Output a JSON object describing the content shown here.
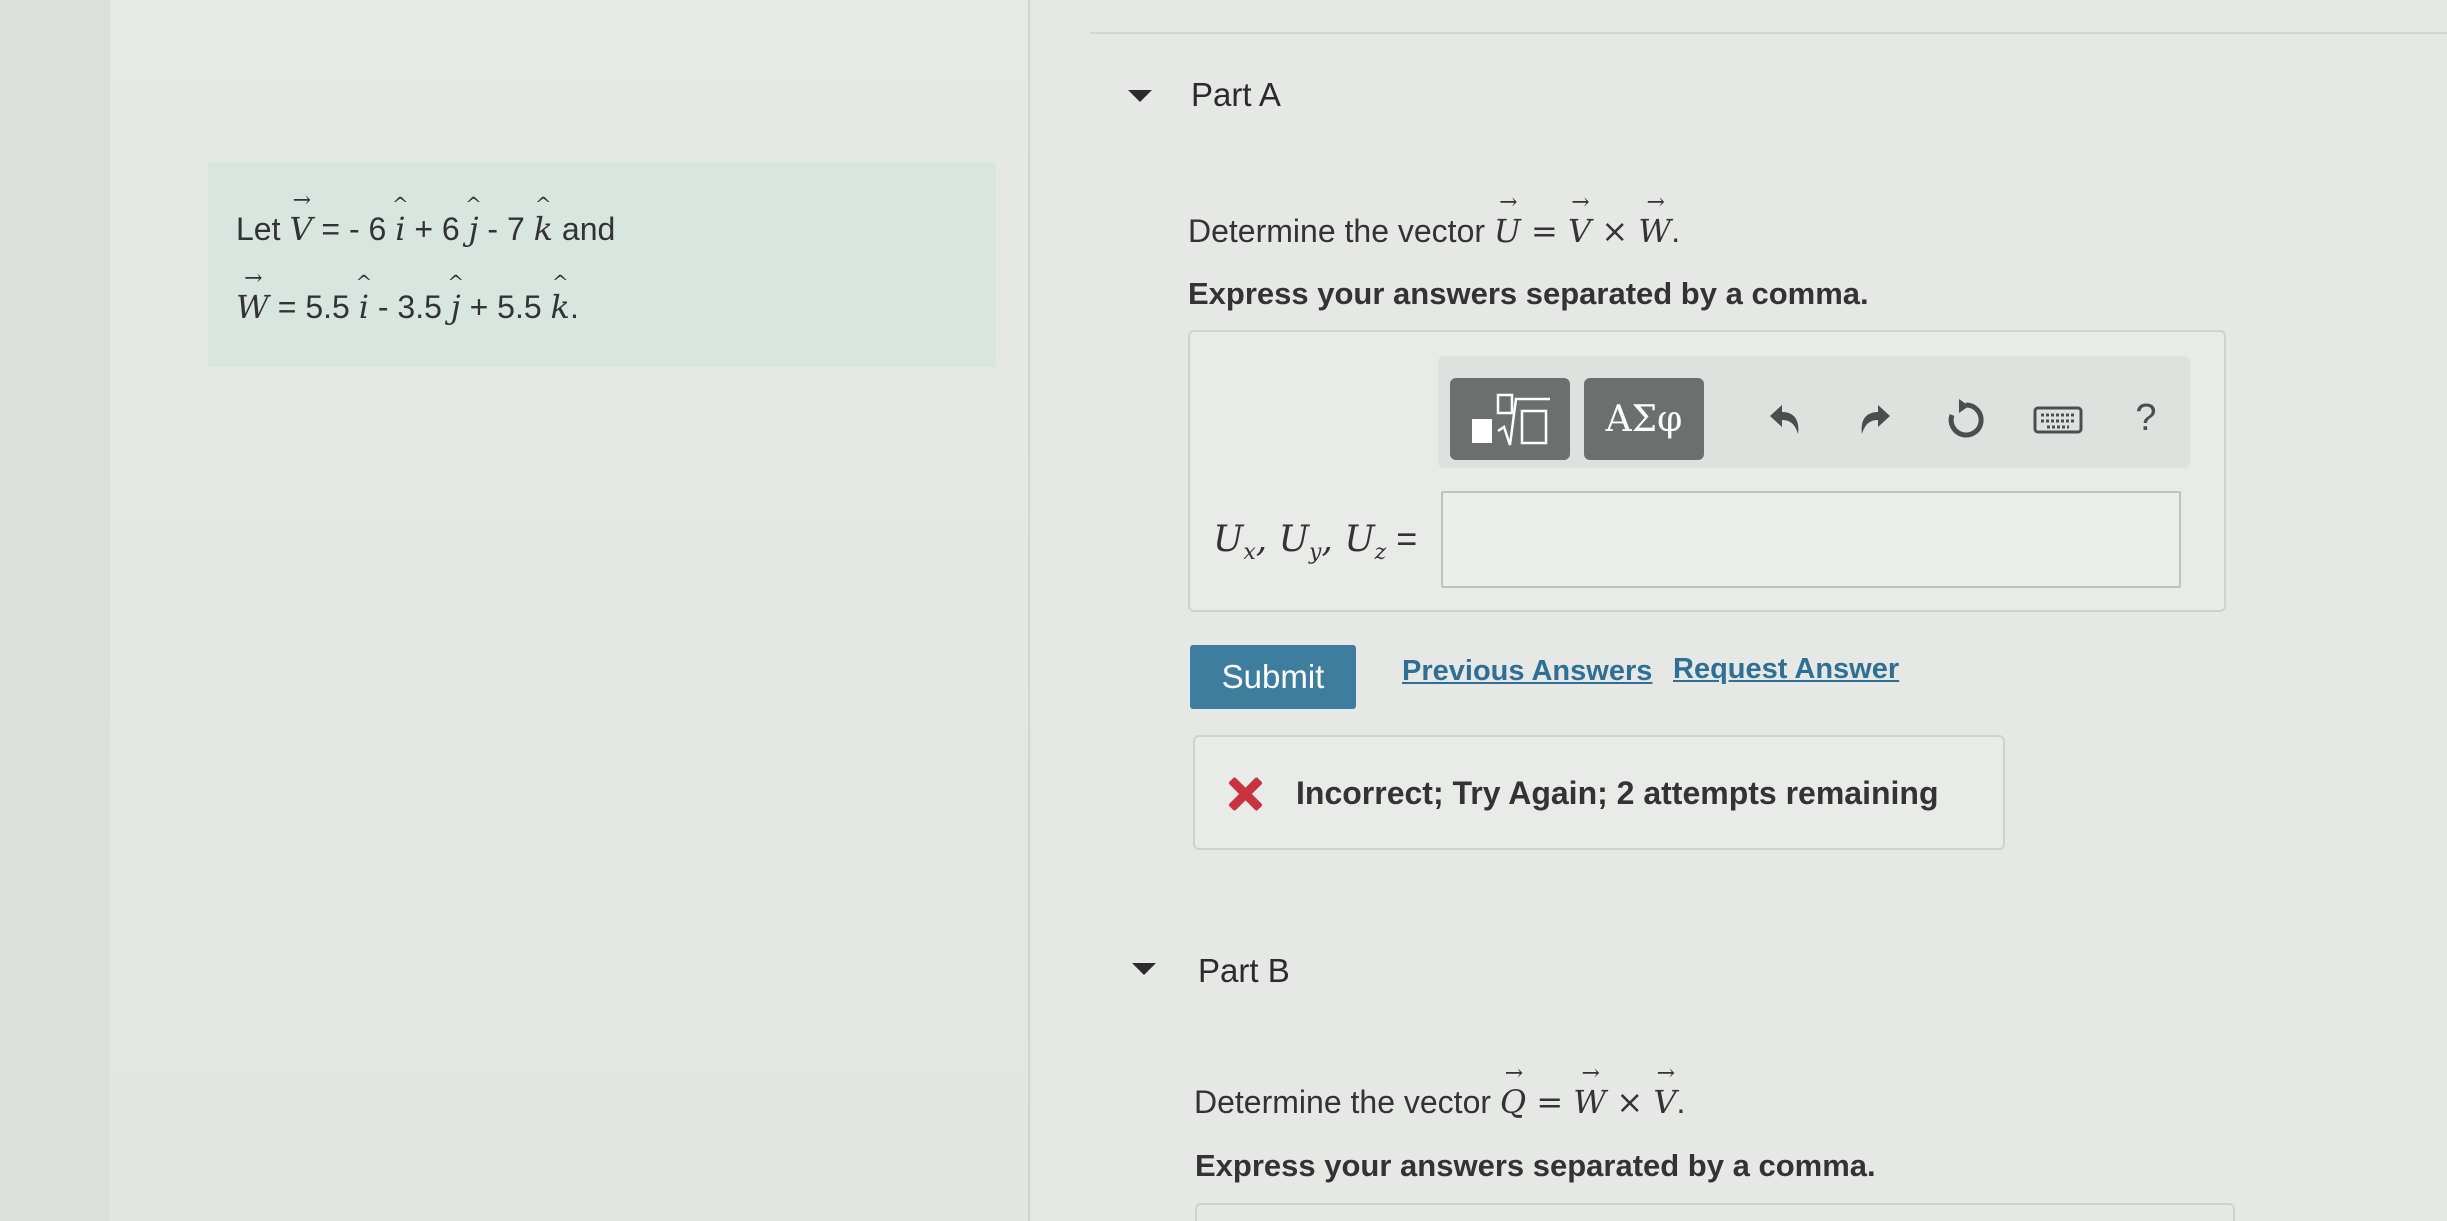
{
  "problem": {
    "line1": {
      "prefix": "Let ",
      "vector": "V",
      "eq": " = - 6 ",
      "i": "i",
      "plus_j": " + 6 ",
      "j": "j",
      "minus_k": " - 7 ",
      "k": "k",
      "suffix": " and"
    },
    "line2": {
      "vector": "W",
      "eq": " = 5.5 ",
      "i": "i",
      "minus_j": " - 3.5 ",
      "j": "j",
      "plus_k": " + 5.5 ",
      "k": "k",
      "suffix": "."
    }
  },
  "partA": {
    "title": "Part A",
    "prompt_prefix": "Determine the vector ",
    "prompt_U": "U",
    "prompt_eq": " = ",
    "prompt_V": "V",
    "prompt_times": " × ",
    "prompt_W": "W",
    "prompt_end": ".",
    "instruction": "Express your answers separated by a comma.",
    "toolbar": {
      "templates_icon": "templates-icon",
      "symbols_label": "ΑΣφ",
      "undo_icon": "undo-icon",
      "redo_icon": "redo-icon",
      "reset_icon": "reset-icon",
      "keyboard_icon": "keyboard-icon",
      "help_label": "?"
    },
    "lhs": {
      "U1": "U",
      "x": "x",
      "sep1": ", ",
      "U2": "U",
      "y": "y",
      "sep2": ", ",
      "U3": "U",
      "z": "z",
      "eq": " ="
    },
    "answer_value": "",
    "submit_label": "Submit",
    "previous_answers_label": "Previous Answers",
    "request_answer_label": "Request Answer",
    "feedback": "Incorrect; Try Again; 2 attempts remaining"
  },
  "partB": {
    "title": "Part B",
    "prompt_prefix": "Determine the vector ",
    "prompt_Q": "Q",
    "prompt_eq": " = ",
    "prompt_W": "W",
    "prompt_times": " × ",
    "prompt_V": "V",
    "prompt_end": ".",
    "instruction": "Express your answers separated by a comma."
  },
  "colors": {
    "problem_box": "#d8e6df",
    "submit": "#3f7d9f",
    "link": "#2f6f96",
    "error": "#c9323f"
  }
}
